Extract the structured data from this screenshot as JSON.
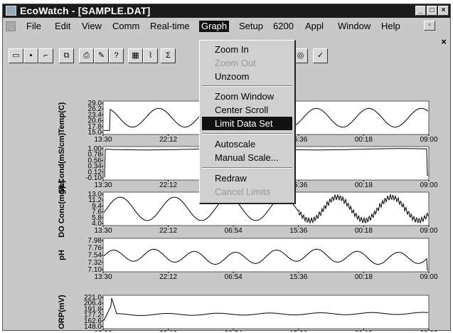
{
  "window": {
    "title": "EcoWatch - [SAMPLE.DAT]"
  },
  "menubar": {
    "items": [
      {
        "label": "File"
      },
      {
        "label": "Edit"
      },
      {
        "label": "View"
      },
      {
        "label": "Comm"
      },
      {
        "label": "Real-time"
      },
      {
        "label": "Graph"
      },
      {
        "label": "Setup"
      },
      {
        "label": "6200"
      },
      {
        "label": "Appl"
      },
      {
        "label": "Window"
      },
      {
        "label": "Help"
      }
    ],
    "active": "Graph"
  },
  "graph_menu": {
    "items": [
      {
        "label": "Zoom In",
        "enabled": true
      },
      {
        "label": "Zoom Out",
        "enabled": false
      },
      {
        "label": "Unzoom",
        "enabled": true
      },
      {
        "label": "Zoom Window",
        "enabled": true
      },
      {
        "label": "Center Scroll",
        "enabled": true
      },
      {
        "label": "Limit Data Set",
        "enabled": true,
        "selected": true
      },
      {
        "label": "Autoscale",
        "enabled": true
      },
      {
        "label": "Manual Scale...",
        "enabled": true
      },
      {
        "label": "Redraw",
        "enabled": true
      },
      {
        "label": "Cancel Limits",
        "enabled": false
      }
    ]
  },
  "toolbar": {
    "icons": [
      "open-icon",
      "save-icon",
      "print-setup-icon",
      "copy-icon",
      "print-icon",
      "pen-icon",
      "help-cursor-icon",
      "table-icon",
      "graph-icon",
      "sigma-icon",
      "search-icon",
      "report-icon"
    ]
  },
  "chart_data": {
    "type": "line",
    "x_ticks": [
      "13:30",
      "22:12",
      "06:54",
      "15:36",
      "00:18",
      "09:00"
    ],
    "panels": [
      {
        "ylabel": "Temp(C)",
        "ticks": [
          "29.0",
          "26.2",
          "23.4",
          "20.6",
          "17.8",
          "15.0"
        ],
        "ylim": [
          15.0,
          29.0
        ]
      },
      {
        "ylabel": "SpCond(mS/cm)",
        "ticks": [
          "1.00",
          "0.78",
          "0.56",
          "0.34",
          "0.12",
          "-0.10"
        ],
        "ylim": [
          -0.1,
          1.0
        ]
      },
      {
        "ylabel": "DO Conc(mg/L)",
        "ticks": [
          "13.0",
          "11.2",
          "9.4",
          "7.6",
          "5.8",
          "4.0"
        ],
        "ylim": [
          4.0,
          13.0
        ]
      },
      {
        "ylabel": "pH",
        "ticks": [
          "7.98",
          "7.76",
          "7.54",
          "7.32",
          "7.10"
        ],
        "ylim": [
          7.1,
          7.98
        ]
      },
      {
        "ylabel": "ORP(mV)",
        "ticks": [
          "221.0",
          "206.4",
          "191.8",
          "177.2",
          "162.6",
          "148.0"
        ],
        "ylim": [
          148.0,
          221.0
        ]
      }
    ]
  }
}
